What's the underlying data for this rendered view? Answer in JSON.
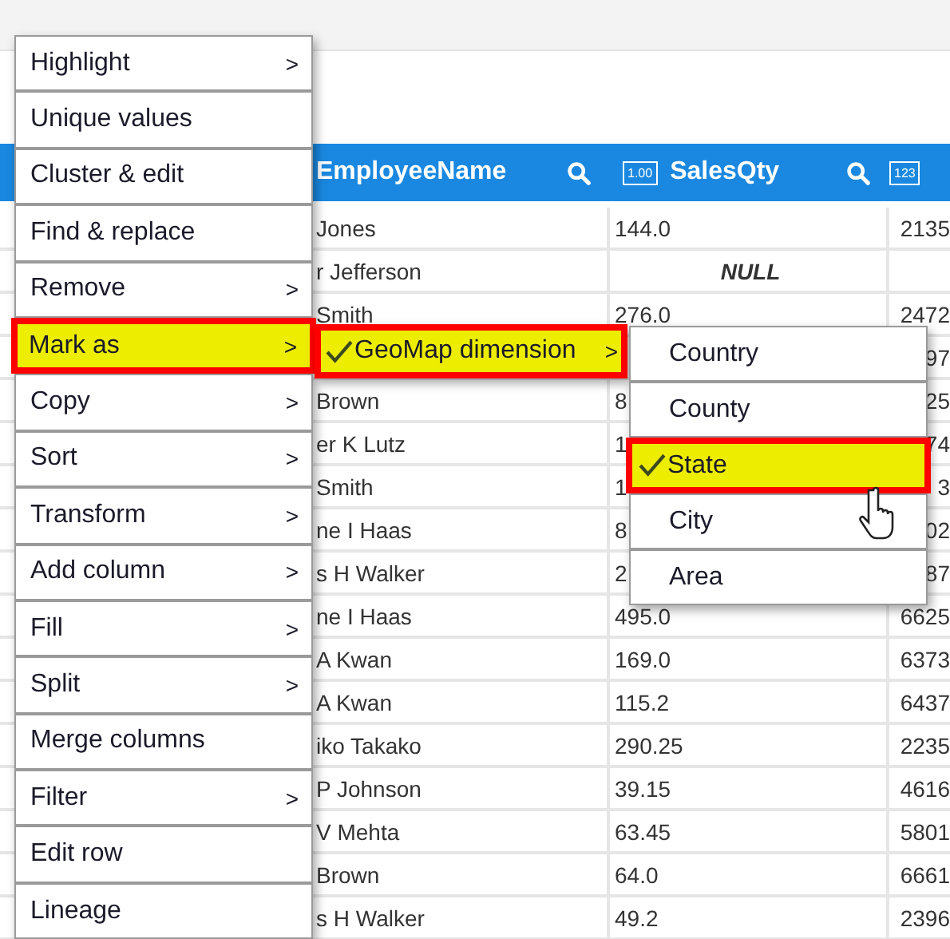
{
  "table": {
    "columns": [
      {
        "name": "EmployeeName"
      },
      {
        "name": "SalesQty",
        "type_badge": "1.00"
      },
      {
        "type_badge": "123"
      }
    ],
    "rows": [
      {
        "name": "Jones",
        "qty": "144.0",
        "column_3": "2135",
        "qty_null": false
      },
      {
        "name": "r Jefferson",
        "qty": "NULL",
        "qty_null": true
      },
      {
        "name": "Smith",
        "qty": "276.0",
        "column_3": "2472",
        "qty_null": false
      },
      {
        "column_3": "97"
      },
      {
        "name": "Brown",
        "qty": "8",
        "column_3": "25",
        "qty_null": false
      },
      {
        "name": "er K Lutz",
        "qty": "1",
        "column_3": "74",
        "qty_null": false
      },
      {
        "name": "Smith",
        "qty": "1",
        "column_3": "3",
        "qty_null": false
      },
      {
        "name": "ne I Haas",
        "qty": "8",
        "column_3": "02",
        "qty_null": false
      },
      {
        "name": "s H Walker",
        "qty": "2",
        "column_3": "87",
        "qty_null": false
      },
      {
        "name": "ne I Haas",
        "qty": "495.0",
        "column_3": "6625",
        "qty_null": false
      },
      {
        "name": "A Kwan",
        "qty": "169.0",
        "column_3": "6373",
        "qty_null": false
      },
      {
        "name": "A Kwan",
        "qty": "115.2",
        "column_3": "6437",
        "qty_null": false
      },
      {
        "name": "iko Takako",
        "qty": "290.25",
        "column_3": "2235",
        "qty_null": false
      },
      {
        "name": "P Johnson",
        "qty": "39.15",
        "column_3": "4616",
        "qty_null": false
      },
      {
        "name": "V Mehta",
        "qty": "63.45",
        "column_3": "5801",
        "qty_null": false
      },
      {
        "name": "Brown",
        "qty": "64.0",
        "column_3": "6661",
        "qty_null": false
      },
      {
        "name": "s H Walker",
        "qty": "49.2",
        "column_3": "2396",
        "qty_null": false
      }
    ]
  },
  "context_menu": {
    "items": [
      {
        "label": "Highlight",
        "arrow": ">",
        "selected": false
      },
      {
        "label": "Unique values",
        "selected": false
      },
      {
        "label": "Cluster & edit",
        "selected": false
      },
      {
        "label": "Find & replace",
        "selected": false
      },
      {
        "label": "Remove",
        "arrow": ">",
        "selected": false
      },
      {
        "label": "Mark as",
        "arrow": ">",
        "selected": true
      },
      {
        "label": "Copy",
        "arrow": ">",
        "selected": false
      },
      {
        "label": "Sort",
        "arrow": ">",
        "selected": false
      },
      {
        "label": "Transform",
        "arrow": ">",
        "selected": false
      },
      {
        "label": "Add column",
        "arrow": ">",
        "selected": false
      },
      {
        "label": "Fill",
        "arrow": ">",
        "selected": false
      },
      {
        "label": "Split",
        "arrow": ">",
        "selected": false
      },
      {
        "label": "Merge columns",
        "selected": false
      },
      {
        "label": "Filter",
        "arrow": ">",
        "selected": false
      },
      {
        "label": "Edit row",
        "selected": false
      },
      {
        "label": "Lineage",
        "selected": false
      }
    ]
  },
  "mark_as_submenu": {
    "items": [
      {
        "label": "GeoMap dimension",
        "arrow": ">",
        "checked": true,
        "selected": true
      }
    ]
  },
  "geomap_submenu": {
    "items": [
      {
        "label": "Country",
        "checked": false,
        "selected": false
      },
      {
        "label": "County",
        "checked": false,
        "selected": false
      },
      {
        "label": "State",
        "checked": true,
        "selected": true
      },
      {
        "label": "City",
        "checked": false,
        "selected": false
      },
      {
        "label": "Area",
        "checked": false,
        "selected": false
      }
    ]
  }
}
